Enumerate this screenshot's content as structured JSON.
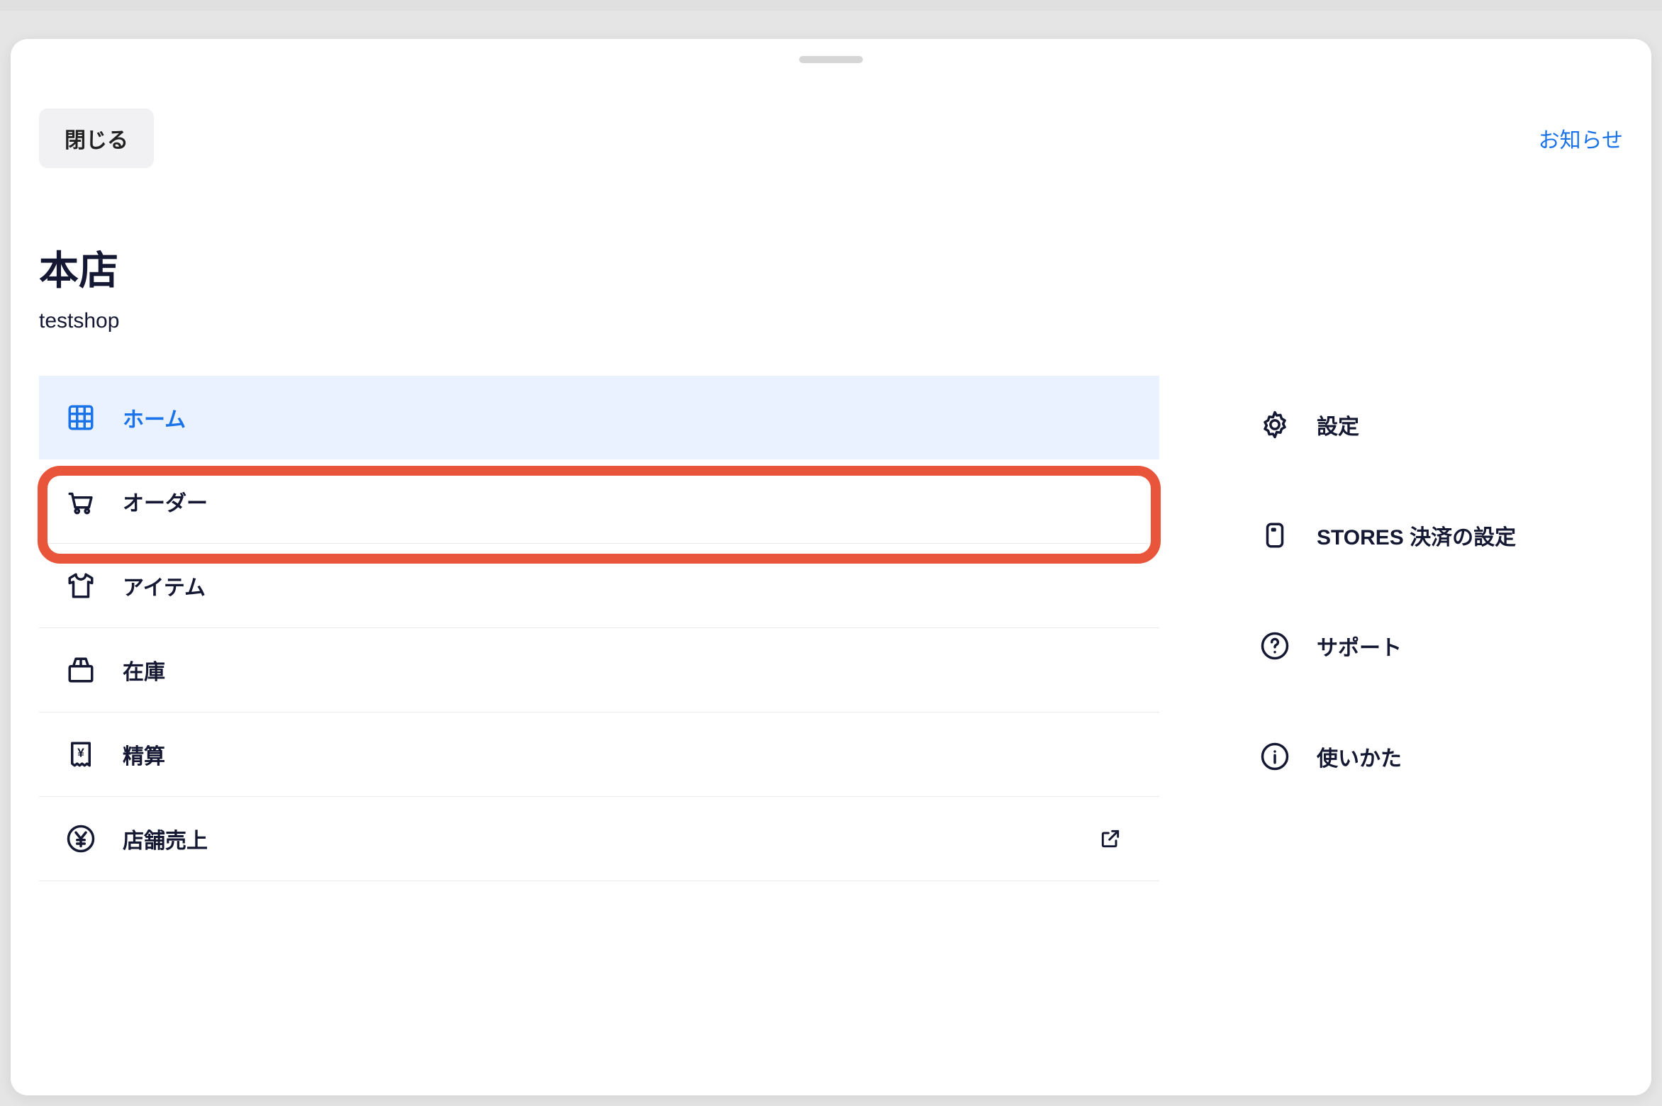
{
  "topbar": {
    "close_label": "閉じる",
    "notice_label": "お知らせ"
  },
  "store": {
    "title": "本店",
    "subtitle": "testshop"
  },
  "menu": {
    "items": [
      {
        "key": "home",
        "label": "ホーム",
        "icon": "grid-icon",
        "active": true
      },
      {
        "key": "order",
        "label": "オーダー",
        "icon": "cart-icon"
      },
      {
        "key": "item",
        "label": "アイテム",
        "icon": "shirt-icon"
      },
      {
        "key": "stock",
        "label": "在庫",
        "icon": "package-icon"
      },
      {
        "key": "settlement",
        "label": "精算",
        "icon": "receipt-icon"
      },
      {
        "key": "store-sales",
        "label": "店舗売上",
        "icon": "yen-circle-icon",
        "external": true
      }
    ]
  },
  "side": {
    "items": [
      {
        "key": "settings",
        "label": "設定",
        "icon": "gear-icon"
      },
      {
        "key": "payment-settings",
        "label": "STORES 決済の設定",
        "icon": "device-icon"
      },
      {
        "key": "support",
        "label": "サポート",
        "icon": "help-icon"
      },
      {
        "key": "howto",
        "label": "使いかた",
        "icon": "info-icon"
      }
    ]
  },
  "colors": {
    "accent": "#1a73e8",
    "highlight": "#e8553a",
    "text": "#141832"
  }
}
